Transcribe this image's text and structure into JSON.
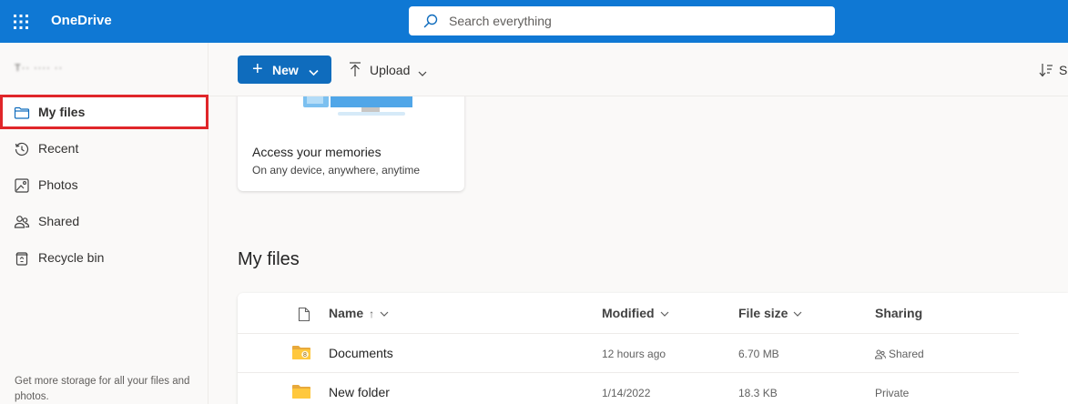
{
  "app": {
    "title": "OneDrive",
    "accent_color": "#0f78d4",
    "waffle_icon": "app-launcher-icon"
  },
  "search": {
    "placeholder": "Search everything",
    "value": ""
  },
  "sidebar": {
    "user_name": "T·· ···· ··",
    "items": [
      {
        "label": "My files",
        "icon": "folder-icon",
        "selected": true
      },
      {
        "label": "Recent",
        "icon": "history-icon",
        "selected": false
      },
      {
        "label": "Photos",
        "icon": "image-icon",
        "selected": false
      },
      {
        "label": "Shared",
        "icon": "people-icon",
        "selected": false
      },
      {
        "label": "Recycle bin",
        "icon": "recycle-bin-icon",
        "selected": false
      }
    ],
    "storage_note": "Get more storage for all your files and photos.",
    "highlight_color": "#e0262a"
  },
  "command_bar": {
    "new_label": "New",
    "upload_label": "Upload",
    "sort_label": "Sort"
  },
  "promo_card": {
    "title": "Access your memories",
    "subtitle": "On any device, anywhere, anytime"
  },
  "main": {
    "section_title": "My files",
    "columns": {
      "name": "Name",
      "modified": "Modified",
      "size": "File size",
      "sharing": "Sharing"
    },
    "sort_indicator": "↑",
    "rows": [
      {
        "name": "Documents",
        "modified": "12 hours ago",
        "size": "6.70 MB",
        "sharing": "Shared",
        "icon": "shared-folder-icon"
      },
      {
        "name": "New folder",
        "modified": "1/14/2022",
        "size": "18.3 KB",
        "sharing": "Private",
        "icon": "folder-icon"
      }
    ]
  }
}
